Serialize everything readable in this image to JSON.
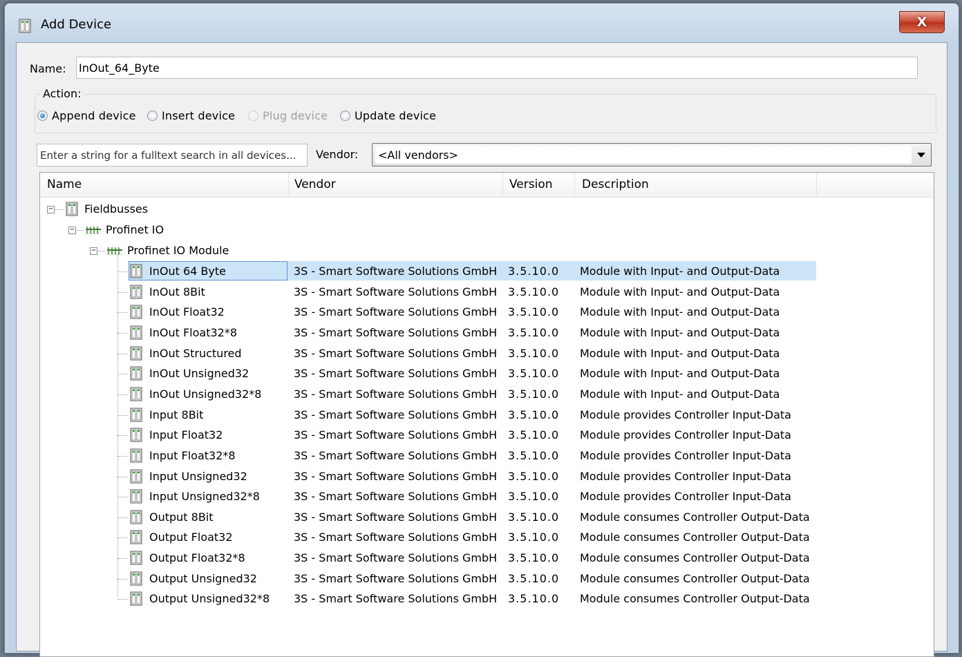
{
  "window": {
    "title": "Add Device",
    "close_label": "X",
    "title_icon": "device-icon"
  },
  "name_field": {
    "label": "Name:",
    "value": "InOut_64_Byte"
  },
  "action": {
    "legend": "Action:",
    "options": [
      {
        "label": "Append device",
        "checked": true,
        "disabled": false
      },
      {
        "label": "Insert device",
        "checked": false,
        "disabled": false
      },
      {
        "label": "Plug device",
        "checked": false,
        "disabled": true
      },
      {
        "label": "Update device",
        "checked": false,
        "disabled": false
      }
    ]
  },
  "search": {
    "placeholder": "Enter a string for a fulltext search in all devices..."
  },
  "vendor": {
    "label": "Vendor:",
    "value": "<All vendors>"
  },
  "table": {
    "columns": [
      "Name",
      "Vendor",
      "Version",
      "Description"
    ],
    "tree": [
      {
        "name": "Fieldbusses",
        "icon": "device-icon"
      },
      {
        "name": "Profinet IO",
        "icon": "fieldbus-icon"
      },
      {
        "name": "Profinet IO Module",
        "icon": "fieldbus-icon"
      }
    ],
    "rows": [
      {
        "name": "InOut 64 Byte",
        "vendor": "3S - Smart Software Solutions GmbH",
        "version": "3.5.10.0",
        "description": "Module with Input- and Output-Data",
        "selected": true
      },
      {
        "name": "InOut 8Bit",
        "vendor": "3S - Smart Software Solutions GmbH",
        "version": "3.5.10.0",
        "description": "Module with Input- and Output-Data"
      },
      {
        "name": "InOut Float32",
        "vendor": "3S - Smart Software Solutions GmbH",
        "version": "3.5.10.0",
        "description": "Module with Input- and Output-Data"
      },
      {
        "name": "InOut Float32*8",
        "vendor": "3S - Smart Software Solutions GmbH",
        "version": "3.5.10.0",
        "description": "Module with Input- and Output-Data"
      },
      {
        "name": "InOut Structured",
        "vendor": "3S - Smart Software Solutions GmbH",
        "version": "3.5.10.0",
        "description": "Module with Input- and Output-Data"
      },
      {
        "name": "InOut Unsigned32",
        "vendor": "3S - Smart Software Solutions GmbH",
        "version": "3.5.10.0",
        "description": "Module with Input- and Output-Data"
      },
      {
        "name": "InOut Unsigned32*8",
        "vendor": "3S - Smart Software Solutions GmbH",
        "version": "3.5.10.0",
        "description": "Module with Input- and Output-Data"
      },
      {
        "name": "Input 8Bit",
        "vendor": "3S - Smart Software Solutions GmbH",
        "version": "3.5.10.0",
        "description": "Module provides Controller Input-Data"
      },
      {
        "name": "Input Float32",
        "vendor": "3S - Smart Software Solutions GmbH",
        "version": "3.5.10.0",
        "description": "Module provides Controller Input-Data"
      },
      {
        "name": "Input Float32*8",
        "vendor": "3S - Smart Software Solutions GmbH",
        "version": "3.5.10.0",
        "description": "Module provides Controller Input-Data"
      },
      {
        "name": "Input Unsigned32",
        "vendor": "3S - Smart Software Solutions GmbH",
        "version": "3.5.10.0",
        "description": "Module provides Controller Input-Data"
      },
      {
        "name": "Input Unsigned32*8",
        "vendor": "3S - Smart Software Solutions GmbH",
        "version": "3.5.10.0",
        "description": "Module provides Controller Input-Data"
      },
      {
        "name": "Output 8Bit",
        "vendor": "3S - Smart Software Solutions GmbH",
        "version": "3.5.10.0",
        "description": "Module consumes Controller Output-Data"
      },
      {
        "name": "Output Float32",
        "vendor": "3S - Smart Software Solutions GmbH",
        "version": "3.5.10.0",
        "description": "Module consumes Controller Output-Data"
      },
      {
        "name": "Output Float32*8",
        "vendor": "3S - Smart Software Solutions GmbH",
        "version": "3.5.10.0",
        "description": "Module consumes Controller Output-Data"
      },
      {
        "name": "Output Unsigned32",
        "vendor": "3S - Smart Software Solutions GmbH",
        "version": "3.5.10.0",
        "description": "Module consumes Controller Output-Data"
      },
      {
        "name": "Output Unsigned32*8",
        "vendor": "3S - Smart Software Solutions GmbH",
        "version": "3.5.10.0",
        "description": "Module consumes Controller Output-Data"
      }
    ]
  },
  "colors": {
    "selection": "#cce4f7",
    "selection_border": "#5b8fd4",
    "close_button": "#c7432e"
  }
}
